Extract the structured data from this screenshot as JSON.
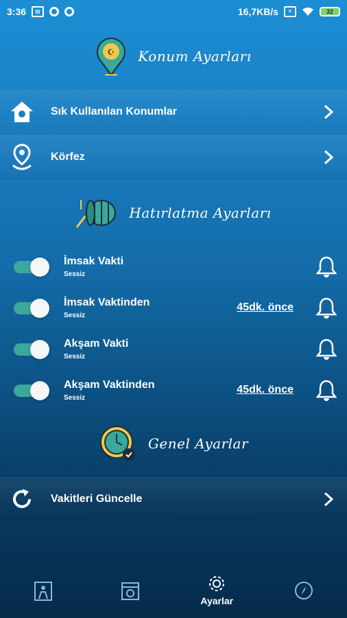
{
  "status_bar": {
    "time": "3:36",
    "speed": "16,7KB/s",
    "battery": "32"
  },
  "sections": {
    "location": {
      "title": "Konum Ayarları"
    },
    "reminder": {
      "title": "Hatırlatma Ayarları"
    },
    "general": {
      "title": "Genel Ayarlar"
    }
  },
  "location_items": [
    {
      "label": "Sık Kullanılan Konumlar",
      "icon": "home-pin-icon"
    },
    {
      "label": "Körfez",
      "icon": "location-pin-icon"
    }
  ],
  "reminders": [
    {
      "title": "İmsak Vakti",
      "subtitle": "Sessiz",
      "link": "",
      "enabled": true
    },
    {
      "title": "İmsak Vaktinden",
      "subtitle": "Sessiz",
      "link": "45dk. önce",
      "enabled": true
    },
    {
      "title": "Akşam Vakti",
      "subtitle": "Sessiz",
      "link": "",
      "enabled": true
    },
    {
      "title": "Akşam Vaktinden",
      "subtitle": "Sessiz",
      "link": "45dk. önce",
      "enabled": true
    }
  ],
  "general_items": [
    {
      "label": "Vakitleri Güncelle",
      "icon": "refresh-icon"
    }
  ],
  "bottom_nav": [
    {
      "name": "prayer",
      "label": ""
    },
    {
      "name": "calendar",
      "label": ""
    },
    {
      "name": "settings",
      "label": "Ayarlar",
      "active": true
    },
    {
      "name": "qibla",
      "label": ""
    }
  ]
}
